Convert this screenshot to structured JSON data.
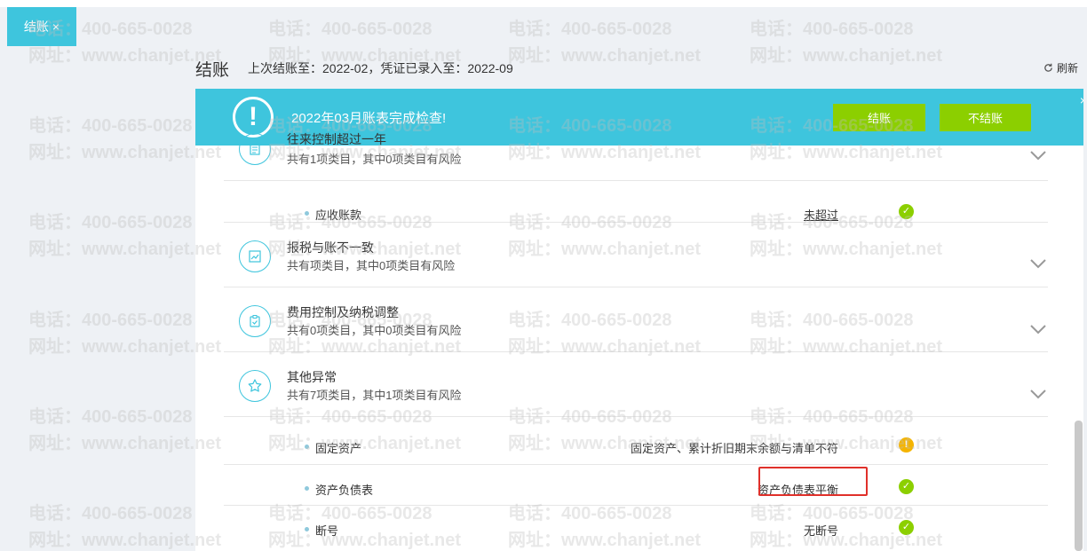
{
  "tab": {
    "label": "结账",
    "close": "×"
  },
  "header": {
    "title": "结账",
    "subtitle": "上次结账至：2022-02，凭证已录入至：2022-09",
    "refresh_label": "刷新"
  },
  "banner": {
    "icon_text": "!",
    "message": "2022年03月账表完成检查!",
    "close_button": "结账",
    "skip_button": "不结账",
    "dismiss": "×"
  },
  "categories": [
    {
      "name": "往来控制超过一年",
      "desc": "共有1项类目，其中0项类目有风险",
      "icon": "document-icon"
    },
    {
      "name": "报税与账不一致",
      "desc": "共有项类目，其中0项类目有风险",
      "icon": "chart-icon"
    },
    {
      "name": "费用控制及纳税调整",
      "desc": "共有0项类目，其中0项类目有风险",
      "icon": "clipboard-icon"
    },
    {
      "name": "其他异常",
      "desc": "共有7项类目，其中1项类目有风险",
      "icon": "star-icon"
    }
  ],
  "items": [
    {
      "name": "应收账款",
      "result": "未超过",
      "status": "ok"
    },
    {
      "name": "固定资产",
      "result": "固定资产、累计折旧期末余额与清单不符",
      "status": "warn"
    },
    {
      "name": "资产负债表",
      "result": "资产负债表平衡",
      "status": "ok"
    },
    {
      "name": "断号",
      "result": "无断号",
      "status": "ok"
    }
  ],
  "watermark": {
    "phone": "电话：400-665-0028",
    "site": "网址：www.chanjet.net"
  },
  "colors": {
    "accent": "#3ec5dd",
    "button": "#8ccf00",
    "warn": "#f5b400",
    "highlight": "#e0302a"
  }
}
